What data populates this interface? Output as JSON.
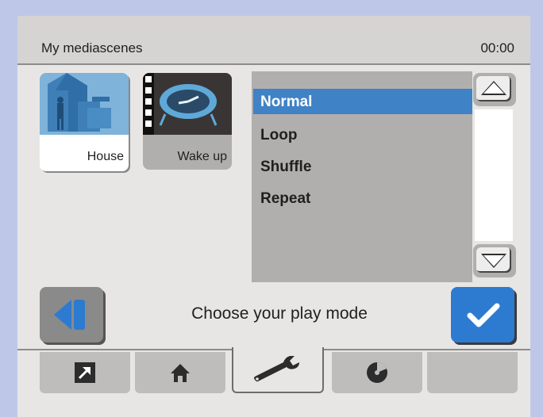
{
  "header": {
    "title": "My mediascenes",
    "clock": "00:00"
  },
  "scenes": [
    {
      "label": "House",
      "icon": "house-icon",
      "selected": true
    },
    {
      "label": "Wake up",
      "icon": "alarm-clock-icon",
      "selected": false
    }
  ],
  "play_modes": {
    "selected": "Normal",
    "items": [
      "Normal",
      "Loop",
      "Shuffle",
      "Repeat"
    ]
  },
  "prompt": "Choose your play mode",
  "tabs": [
    {
      "icon": "shortcut-arrow-icon"
    },
    {
      "icon": "home-icon"
    },
    {
      "icon": "wrench-icon",
      "active": true
    },
    {
      "icon": "media-disc-icon"
    },
    {
      "icon": "empty"
    }
  ],
  "colors": {
    "accent": "#3f82c6",
    "confirm": "#2d7bd1",
    "background": "#e8e6e5",
    "frame": "#bfc7e8"
  }
}
